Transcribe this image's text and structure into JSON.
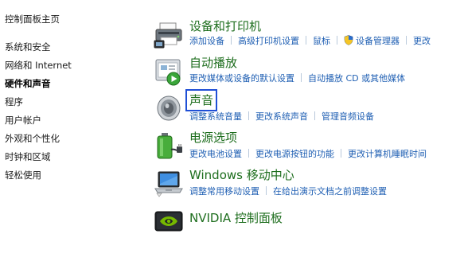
{
  "sidebar": {
    "home": "控制面板主页",
    "items": [
      {
        "label": "系统和安全",
        "current": false
      },
      {
        "label": "网络和 Internet",
        "current": false
      },
      {
        "label": "硬件和声音",
        "current": true
      },
      {
        "label": "程序",
        "current": false
      },
      {
        "label": "用户帐户",
        "current": false
      },
      {
        "label": "外观和个性化",
        "current": false
      },
      {
        "label": "时钟和区域",
        "current": false
      },
      {
        "label": "轻松使用",
        "current": false
      }
    ]
  },
  "categories": [
    {
      "title": "设备和打印机",
      "icon": "printer-icon",
      "links": [
        "添加设备",
        "高级打印机设置",
        "鼠标",
        "设备管理器",
        "更改"
      ],
      "shield_on_link": 3
    },
    {
      "title": "自动播放",
      "icon": "autoplay-icon",
      "links": [
        "更改媒体或设备的默认设置",
        "自动播放 CD 或其他媒体"
      ]
    },
    {
      "title": "声音",
      "icon": "speaker-icon",
      "highlighted": true,
      "links": [
        "调整系统音量",
        "更改系统声音",
        "管理音频设备"
      ]
    },
    {
      "title": "电源选项",
      "icon": "battery-icon",
      "links": [
        "更改电池设置",
        "更改电源按钮的功能",
        "更改计算机睡眠时间"
      ]
    },
    {
      "title": "Windows 移动中心",
      "icon": "laptop-icon",
      "links": [
        "调整常用移动设置",
        "在给出演示文档之前调整设置"
      ]
    },
    {
      "title": "NVIDIA 控制面板",
      "icon": "nvidia-icon",
      "links": []
    }
  ],
  "colors": {
    "link": "#1f5fb3",
    "category_title": "#1e6e1e",
    "highlight_box": "#1f4fd6",
    "nvidia_green": "#76b900"
  }
}
